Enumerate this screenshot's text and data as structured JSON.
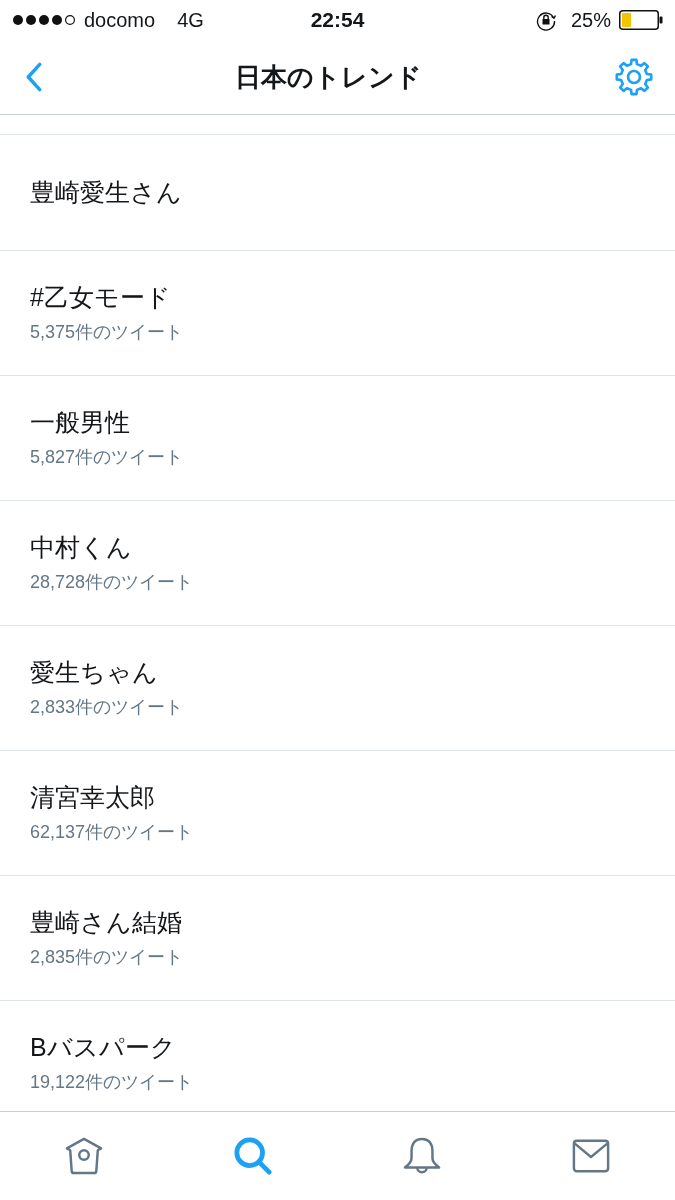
{
  "status_bar": {
    "carrier": "docomo",
    "network": "4G",
    "time": "22:54",
    "battery": "25%"
  },
  "nav_bar": {
    "title": "日本のトレンド"
  },
  "trends": [
    {
      "name": "豊崎愛生さん"
    },
    {
      "name": "#乙女モード",
      "count": "5,375件のツイート"
    },
    {
      "name": "一般男性",
      "count": "5,827件のツイート"
    },
    {
      "name": "中村くん",
      "count": "28,728件のツイート"
    },
    {
      "name": "愛生ちゃん",
      "count": "2,833件のツイート"
    },
    {
      "name": "清宮幸太郎",
      "count": "62,137件のツイート"
    },
    {
      "name": "豊崎さん結婚",
      "count": "2,835件のツイート"
    },
    {
      "name": "Bバスパーク",
      "count": "19,122件のツイート"
    }
  ],
  "tab_bar": {
    "tabs": [
      {
        "kind": "home",
        "selected": false
      },
      {
        "kind": "search",
        "selected": true
      },
      {
        "kind": "notifications",
        "selected": false
      },
      {
        "kind": "messages",
        "selected": false
      }
    ]
  }
}
